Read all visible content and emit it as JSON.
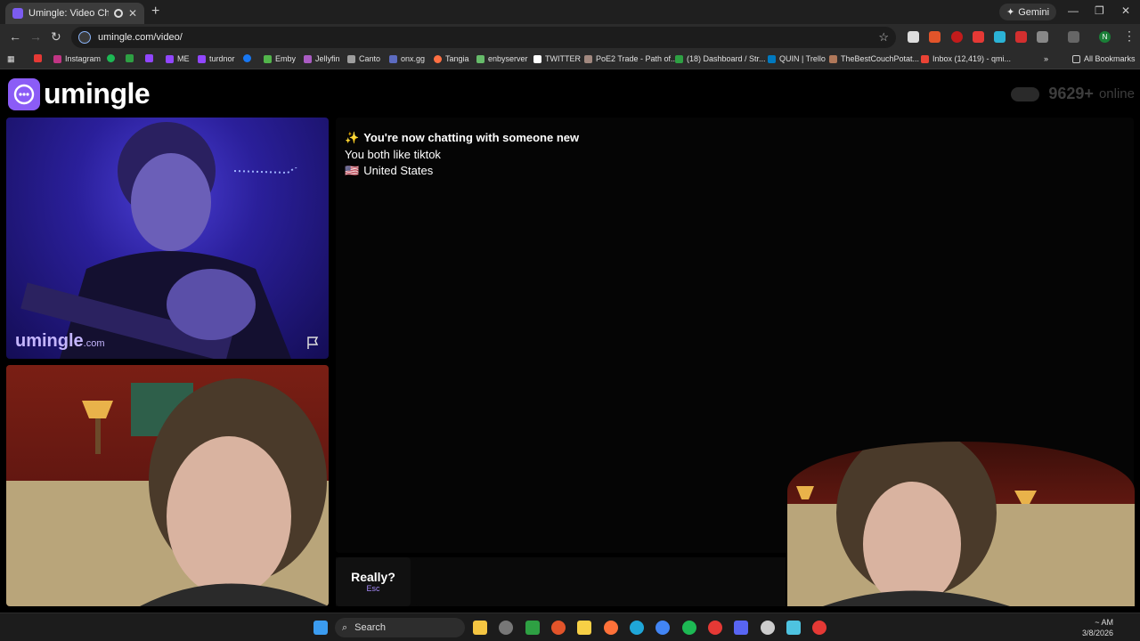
{
  "browser": {
    "tab_title": "Umingle: Video Chat with S",
    "new_tab": "+",
    "gemini_label": "Gemini",
    "url": "umingle.com/video/",
    "bookmarks": [
      "Instagram",
      "ME",
      "turdnor",
      "Emby",
      "Jellyfin",
      "Canto",
      "onx.gg",
      "Tangia",
      "enbyserver",
      "TWITTER",
      "PoE2 Trade - Path of...",
      "(18) Dashboard / Str...",
      "QUIN | Trello",
      "TheBestCouchPotat...",
      "Inbox (12,419) - qmi..."
    ],
    "all_bookmarks": "All Bookmarks",
    "profile_initial": "N"
  },
  "site": {
    "logo_text": "umingle",
    "online_count": "9629+",
    "online_label": "online",
    "watermark_main": "umingle",
    "watermark_suffix": ".com"
  },
  "chat": {
    "line1_emoji": "✨",
    "line1": "You're now chatting with someone new",
    "line2": "You both like tiktok",
    "line3_flag": "🇺🇸",
    "line3": "United States"
  },
  "controls": {
    "skip_label": "Really?",
    "skip_key": "Esc"
  },
  "taskbar": {
    "search_label": "Search",
    "time": "~ AM",
    "date": "3/8/2026"
  },
  "colors": {
    "brand": "#8b5cf6",
    "background": "#000000"
  }
}
